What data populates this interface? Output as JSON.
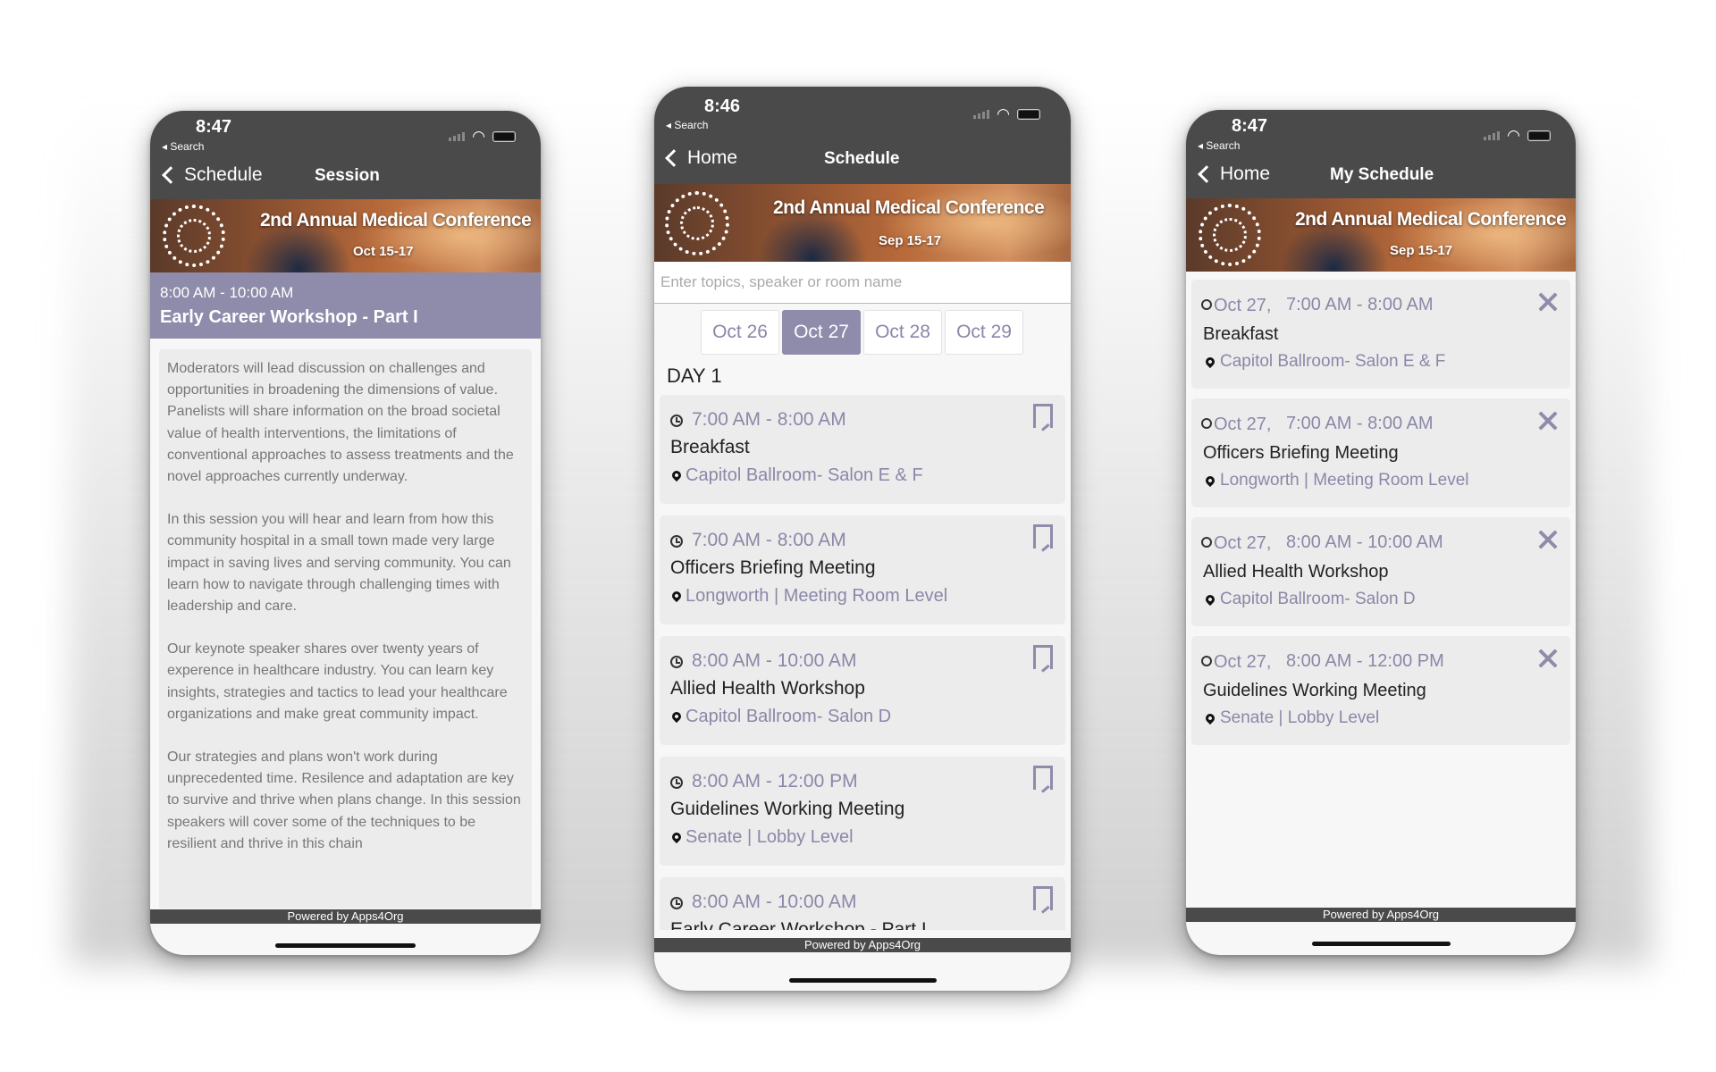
{
  "left_phone": {
    "status_time": "8:47",
    "status_back": "◂ Search",
    "nav_back": "Schedule",
    "nav_title": "Session",
    "banner_title": "2nd Annual Medical Conference",
    "banner_dates": "Oct 15-17",
    "session_time": "8:00 AM - 10:00 AM",
    "session_title": "Early Career Workshop - Part I",
    "description": [
      "Moderators will lead discussion on challenges and opportunities in broadening the dimensions of value. Panelists will share information on the broad societal value of health interventions, the limitations of conventional approaches to assess treatments and the novel approaches currently underway.",
      "In this session you will hear and learn from how this community hospital in a small town made very large impact in saving lives and serving community. You can learn how to navigate through challenging times with leadership and care.",
      "Our keynote speaker shares over twenty years of experence in healthcare industry. You can learn key insights, strategies and tactics to lead your healthcare organizations and make great community impact.",
      "Our strategies and plans won't work during unprecedented time. Resilence and adaptation are key to survive and thrive when plans change. In this session speakers will cover some of the techniques to be resilient and thrive in this chain"
    ],
    "footer": "Powered by Apps4Org"
  },
  "center_phone": {
    "status_time": "8:46",
    "status_back": "◂ Search",
    "nav_back": "Home",
    "nav_title": "Schedule",
    "banner_title": "2nd Annual Medical Conference",
    "banner_dates": "Sep 15-17",
    "search_placeholder": "Enter topics, speaker or room name",
    "dates": [
      "Oct 26",
      "Oct 27",
      "Oct 28",
      "Oct 29"
    ],
    "active_date": "Oct 27",
    "day_label": "DAY 1",
    "events": [
      {
        "time": "7:00 AM - 8:00 AM",
        "title": "Breakfast",
        "location": "Capitol Ballroom- Salon E & F"
      },
      {
        "time": "7:00 AM - 8:00 AM",
        "title": "Officers Briefing Meeting",
        "location": "Longworth | Meeting Room Level"
      },
      {
        "time": "8:00 AM - 10:00 AM",
        "title": "Allied Health Workshop",
        "location": "Capitol Ballroom- Salon D"
      },
      {
        "time": "8:00 AM - 12:00 PM",
        "title": "Guidelines Working Meeting",
        "location": "Senate | Lobby Level"
      },
      {
        "time": "8:00 AM - 10:00 AM",
        "title": "Early Career Workshop - Part I",
        "location": ""
      }
    ],
    "footer": "Powered by Apps4Org"
  },
  "right_phone": {
    "status_time": "8:47",
    "status_back": "◂ Search",
    "nav_back": "Home",
    "nav_title": "My Schedule",
    "banner_title": "2nd Annual Medical Conference",
    "banner_dates": "Sep 15-17",
    "items": [
      {
        "date": "Oct 27,",
        "time": "7:00 AM - 8:00 AM",
        "title": "Breakfast",
        "location": "Capitol Ballroom- Salon E & F"
      },
      {
        "date": "Oct 27,",
        "time": "7:00 AM - 8:00 AM",
        "title": "Officers Briefing Meeting",
        "location": "Longworth | Meeting Room Level"
      },
      {
        "date": "Oct 27,",
        "time": "8:00 AM - 10:00 AM",
        "title": "Allied Health Workshop",
        "location": "Capitol Ballroom- Salon D"
      },
      {
        "date": "Oct 27,",
        "time": "8:00 AM - 12:00 PM",
        "title": "Guidelines Working Meeting",
        "location": "Senate | Lobby Level"
      }
    ],
    "footer": "Powered by Apps4Org"
  },
  "icons": {
    "back": "chevron-left-icon",
    "clock": "clock-icon",
    "location": "map-pin-icon",
    "bookmark": "bookmark-icon",
    "remove": "close-icon",
    "wifi": "wifi-icon",
    "signal": "signal-icon",
    "battery": "battery-icon"
  },
  "colors": {
    "bar": "#4a4a4a",
    "accent": "#8e8bab",
    "card": "#ececec",
    "link_text": "#8a88a8"
  }
}
